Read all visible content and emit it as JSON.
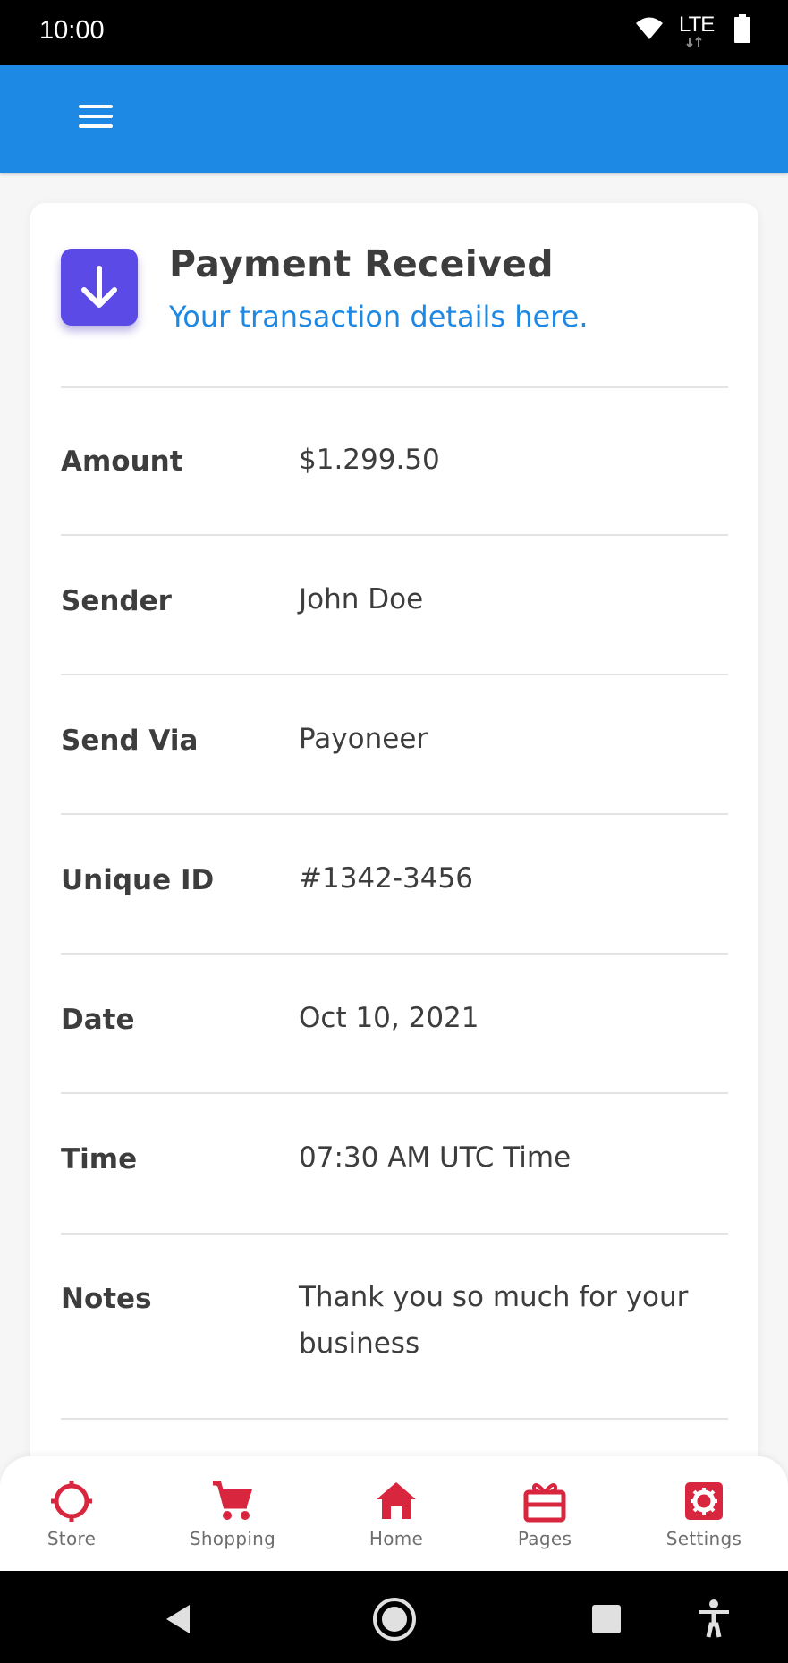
{
  "status_bar": {
    "time": "10:00",
    "network": "LTE",
    "icons": [
      "wifi-icon",
      "lte-signal-icon",
      "battery-icon"
    ]
  },
  "app_bar": {
    "menu_icon": "hamburger-menu-icon",
    "color": "#1e88e5"
  },
  "card": {
    "icon": "arrow-down-icon",
    "icon_color": "#5b4ae6",
    "title": "Payment Received",
    "subtitle": "Your transaction details here.",
    "rows": [
      {
        "label": "Amount",
        "value": "$1.299.50"
      },
      {
        "label": "Sender",
        "value": "John Doe"
      },
      {
        "label": "Send Via",
        "value": "Payoneer"
      },
      {
        "label": "Unique ID",
        "value": "#1342-3456"
      },
      {
        "label": "Date",
        "value": "Oct 10, 2021"
      },
      {
        "label": "Time",
        "value": "07:30 AM UTC Time"
      },
      {
        "label": "Notes",
        "value": "Thank you so much for your business"
      }
    ]
  },
  "bottom_nav": {
    "accent": "#d7263d",
    "items": [
      {
        "label": "Store",
        "icon": "crosshair-icon"
      },
      {
        "label": "Shopping",
        "icon": "cart-icon"
      },
      {
        "label": "Home",
        "icon": "home-icon"
      },
      {
        "label": "Pages",
        "icon": "gift-icon"
      },
      {
        "label": "Settings",
        "icon": "settings-icon"
      }
    ]
  },
  "system_nav": {
    "icons": [
      "back-icon",
      "home-circle-icon",
      "recents-icon",
      "accessibility-icon"
    ]
  }
}
